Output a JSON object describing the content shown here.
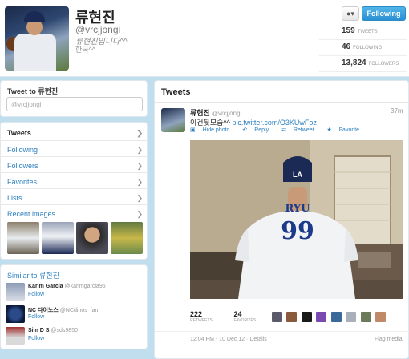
{
  "profile": {
    "name": "류현진",
    "handle": "@vrcjjongi",
    "bio": "류현진입니다^^",
    "location": "한국^^",
    "follow_label": "Following",
    "gear_label": "▾",
    "stats": [
      {
        "value": "159",
        "label": "TWEETS"
      },
      {
        "value": "46",
        "label": "FOLLOWING"
      },
      {
        "value": "13,824",
        "label": "FOLLOWERS"
      }
    ]
  },
  "tweet_to": {
    "title": "Tweet to 류현진",
    "value": "@vrcjjongi"
  },
  "nav": {
    "items": [
      "Tweets",
      "Following",
      "Followers",
      "Favorites",
      "Lists",
      "Recent images"
    ]
  },
  "similar": {
    "title": "Similar to 류현진",
    "people": [
      {
        "name": "Karim Garcia",
        "handle": "@karimgarcia95",
        "follow": "Follow"
      },
      {
        "name": "NC 다이노스",
        "handle": "@NCdinos_fan",
        "follow": "Follow"
      },
      {
        "name": "Sim D S",
        "handle": "@sds9850",
        "follow": "Follow"
      }
    ]
  },
  "tweets": {
    "header": "Tweets",
    "tweet": {
      "name": "류현진",
      "handle": "@vrcjjongi",
      "time": "37m",
      "text": "이건뒷모습^^",
      "link": "pic.twitter.com/O3KUwFoz",
      "actions": [
        "Hide photo",
        "Reply",
        "Retweet",
        "Favorite"
      ],
      "jersey_name": "RYU",
      "jersey_number": "99",
      "retweets": "222",
      "retweets_label": "RETWEETS",
      "favorites": "24",
      "favorites_label": "FAVORITES",
      "timestamp": "12:04 PM - 10 Dec 12 · Details",
      "flag": "Flag media"
    }
  },
  "colors": {
    "background": "#c0deed",
    "link": "#2a7fbf",
    "follow_button": "#2b8fd2"
  }
}
